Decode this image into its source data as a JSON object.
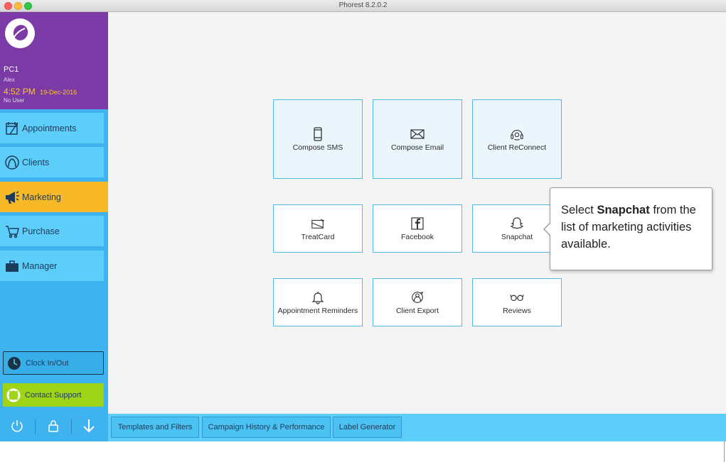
{
  "window": {
    "title": "Phorest 8.2.0.2"
  },
  "sidebar": {
    "profile": {
      "pc_name": "PC1",
      "user": "Alex",
      "time": "4:52 PM",
      "date": "19-Dec-2016",
      "status": "No User"
    },
    "nav": [
      {
        "label": "Appointments",
        "icon": "appointments-icon"
      },
      {
        "label": "Clients",
        "icon": "clients-icon"
      },
      {
        "label": "Marketing",
        "icon": "megaphone-icon",
        "active": true
      },
      {
        "label": "Purchase",
        "icon": "cart-icon"
      },
      {
        "label": "Manager",
        "icon": "briefcase-icon"
      }
    ],
    "clock_button": "Clock In/Out",
    "support_button": "Contact Support",
    "bottom_icons": [
      "power-icon",
      "lock-icon",
      "download-arrow-icon"
    ]
  },
  "main": {
    "tiles": [
      {
        "label": "Compose SMS",
        "icon": "phone-icon"
      },
      {
        "label": "Compose Email",
        "icon": "envelope-icon"
      },
      {
        "label": "Client ReConnect",
        "icon": "headset-icon"
      },
      {
        "label": "TreatCard",
        "icon": "treatcard-icon"
      },
      {
        "label": "Facebook",
        "icon": "facebook-icon"
      },
      {
        "label": "Snapchat",
        "icon": "snapchat-icon"
      },
      {
        "label": "Appointment Reminders",
        "icon": "bell-icon"
      },
      {
        "label": "Client Export",
        "icon": "export-icon"
      },
      {
        "label": "Reviews",
        "icon": "glasses-icon"
      }
    ],
    "callout": {
      "before": "Select ",
      "highlight": "Snapchat",
      "after": " from the list of marketing activities available."
    }
  },
  "bottom_bar": {
    "tabs": [
      "Templates and Filters",
      "Campaign History & Performance",
      "Label Generator"
    ]
  },
  "colors": {
    "purple": "#7b3aa5",
    "sidebar_blue": "#3fb3ef",
    "nav_blue": "#5dcef9",
    "active_orange": "#f7b928",
    "support_green": "#9fd318",
    "tile_border": "#54b9e6"
  }
}
